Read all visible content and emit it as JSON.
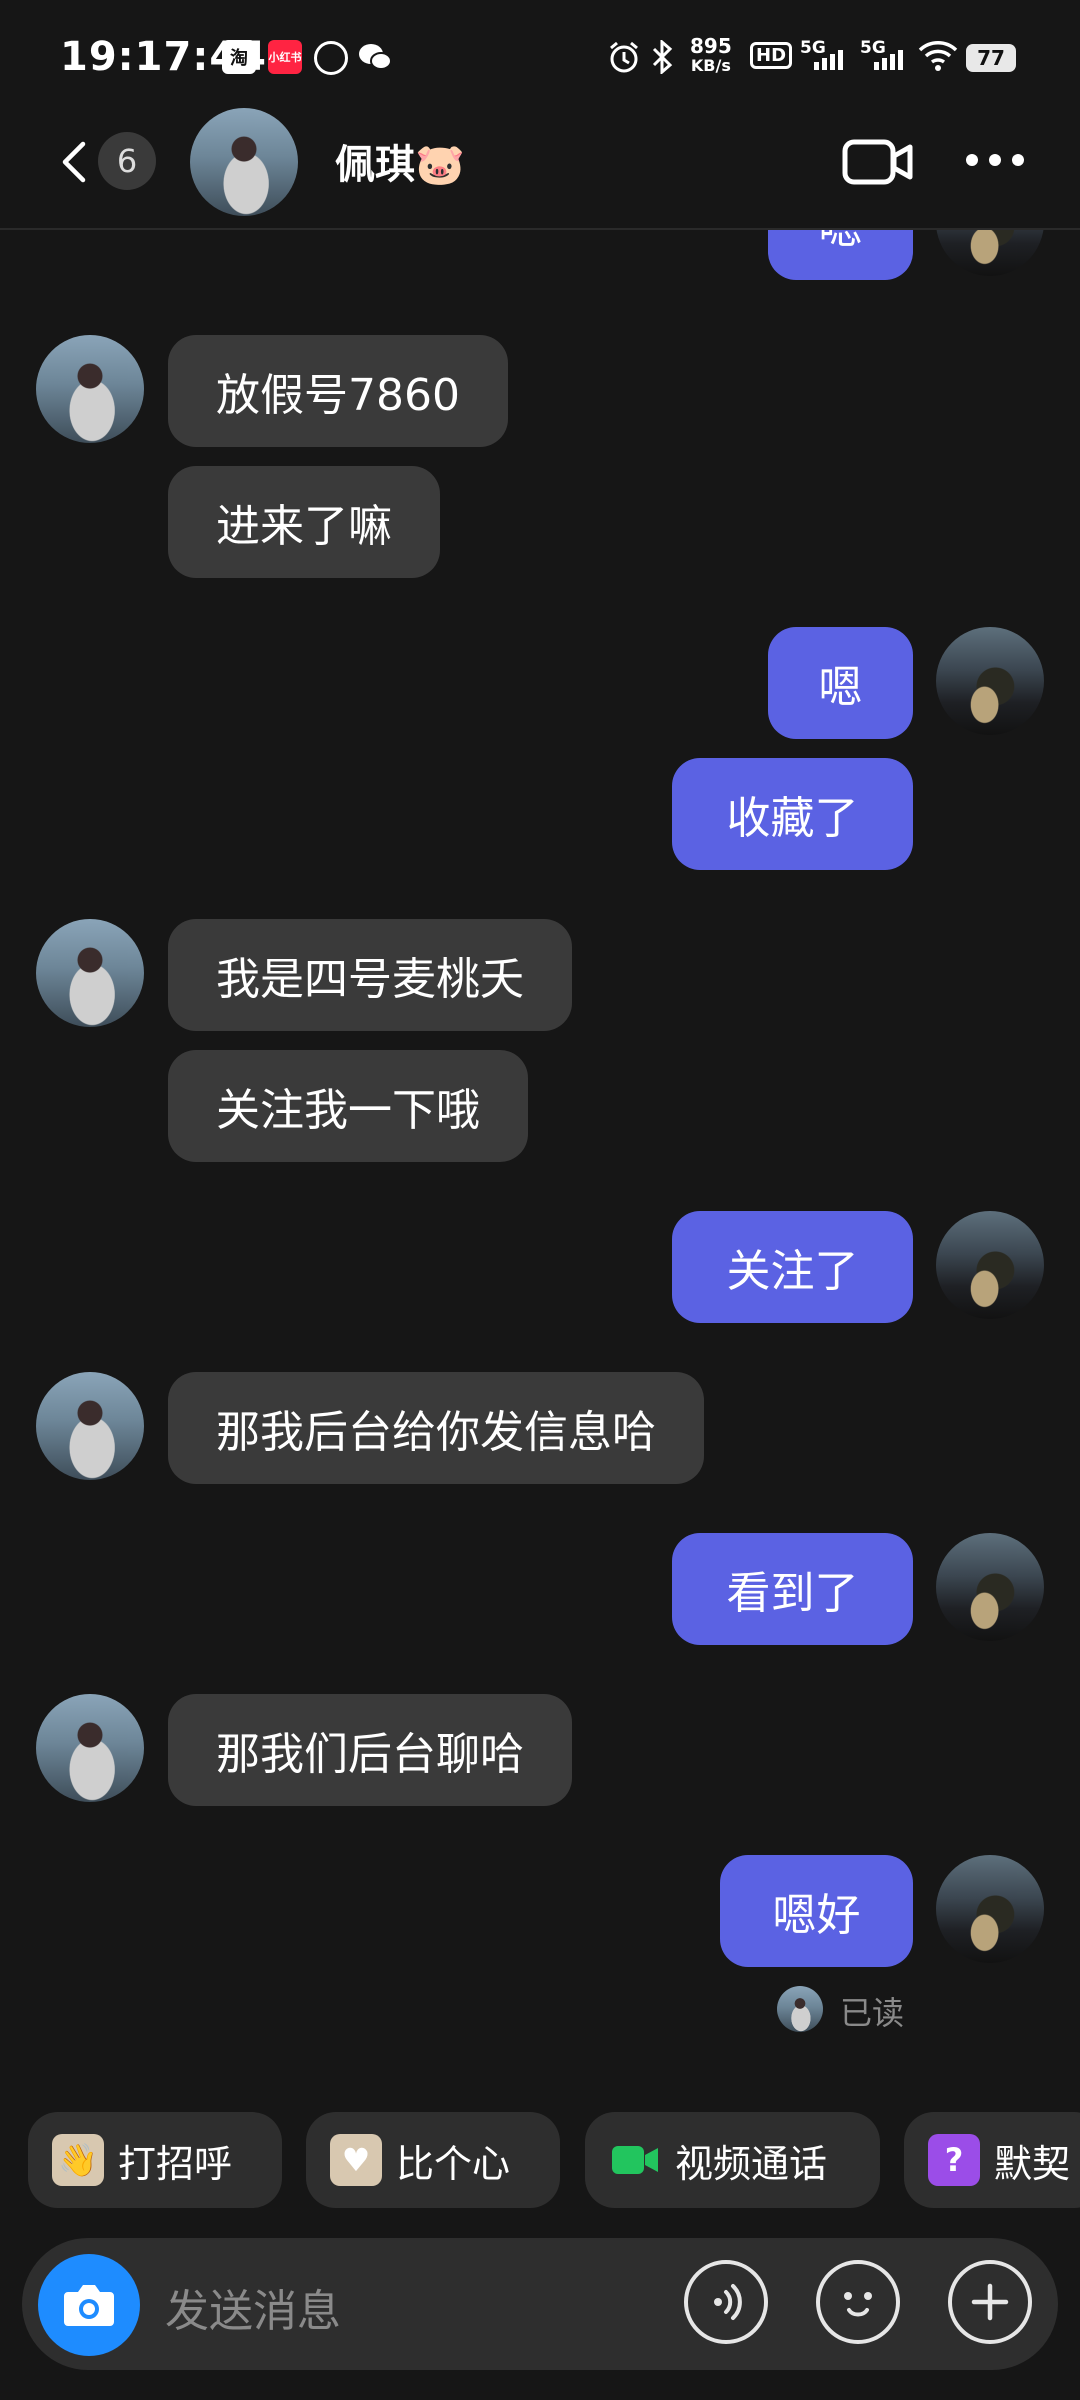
{
  "status_bar": {
    "time": "19:17:44",
    "app_icons": [
      "taobao-icon",
      "xiaohongshu-icon",
      "sync-icon",
      "wechat-icon"
    ],
    "net_speed": "895",
    "net_unit": "KB/s",
    "hd_label": "HD",
    "signal_1": "5G",
    "signal_2": "5G",
    "battery": "77"
  },
  "header": {
    "unread_count": "6",
    "contact_name": "佩琪🐷"
  },
  "messages": [
    {
      "side": "right",
      "text": "嗯",
      "partial": true
    },
    {
      "side": "left",
      "text": "放假号7860"
    },
    {
      "side": "left",
      "text": "进来了嘛"
    },
    {
      "side": "right",
      "text": "嗯"
    },
    {
      "side": "right",
      "text": "收藏了"
    },
    {
      "side": "left",
      "text": "我是四号麦桃夭"
    },
    {
      "side": "left",
      "text": "关注我一下哦"
    },
    {
      "side": "right",
      "text": "关注了"
    },
    {
      "side": "left",
      "text": "那我后台给你发信息哈"
    },
    {
      "side": "right",
      "text": "看到了"
    },
    {
      "side": "left",
      "text": "那我们后台聊哈"
    },
    {
      "side": "right",
      "text": "嗯好"
    }
  ],
  "read_status": "已读",
  "quick_actions": [
    {
      "label": "打招呼",
      "icon": "wave-sticker-icon"
    },
    {
      "label": "比个心",
      "icon": "heart-sticker-icon"
    },
    {
      "label": "视频通话",
      "icon": "video-call-icon"
    },
    {
      "label": "默契",
      "icon": "question-icon"
    }
  ],
  "input": {
    "placeholder": "发送消息"
  },
  "colors": {
    "background": "#161616",
    "sent_bubble": "#5b62e3",
    "received_bubble": "#3a3a3a",
    "camera_button": "#1e8cff"
  }
}
